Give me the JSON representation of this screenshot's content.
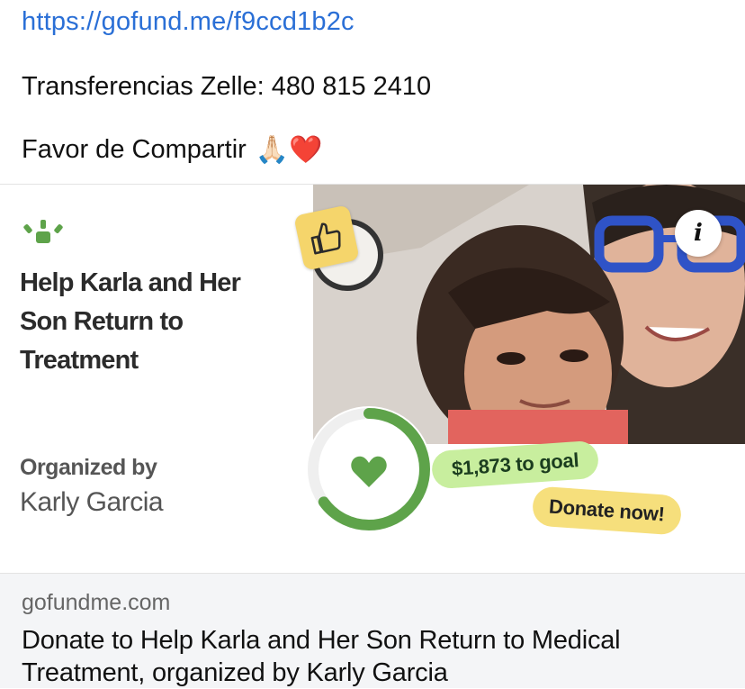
{
  "post": {
    "link": "https://gofund.me/f9ccd1b2c",
    "zelle_text": "Transferencias Zelle: 480 815 2410",
    "share_text": "Favor de Compartir",
    "share_emoji": "🙏🏻❤️"
  },
  "card": {
    "logo_icon": "gofundme-sprout-icon",
    "title": "Help Karla and Her Son Return to Treatment",
    "organized_label": "Organized by",
    "organizer": "Karly Garcia",
    "info_label": "i",
    "goal_text": "$1,873 to goal",
    "donate_text": "Donate now!",
    "progress": 0.65,
    "colors": {
      "brand_green": "#5ea34a",
      "goal_pill": "#c8ee9e",
      "donate_pill": "#f6df7c",
      "thumb_badge": "#f5d56b"
    }
  },
  "link_preview": {
    "domain": "gofundme.com",
    "title": "Donate to Help Karla and Her Son Return to Medical Treatment, organized by Karly Garcia"
  }
}
